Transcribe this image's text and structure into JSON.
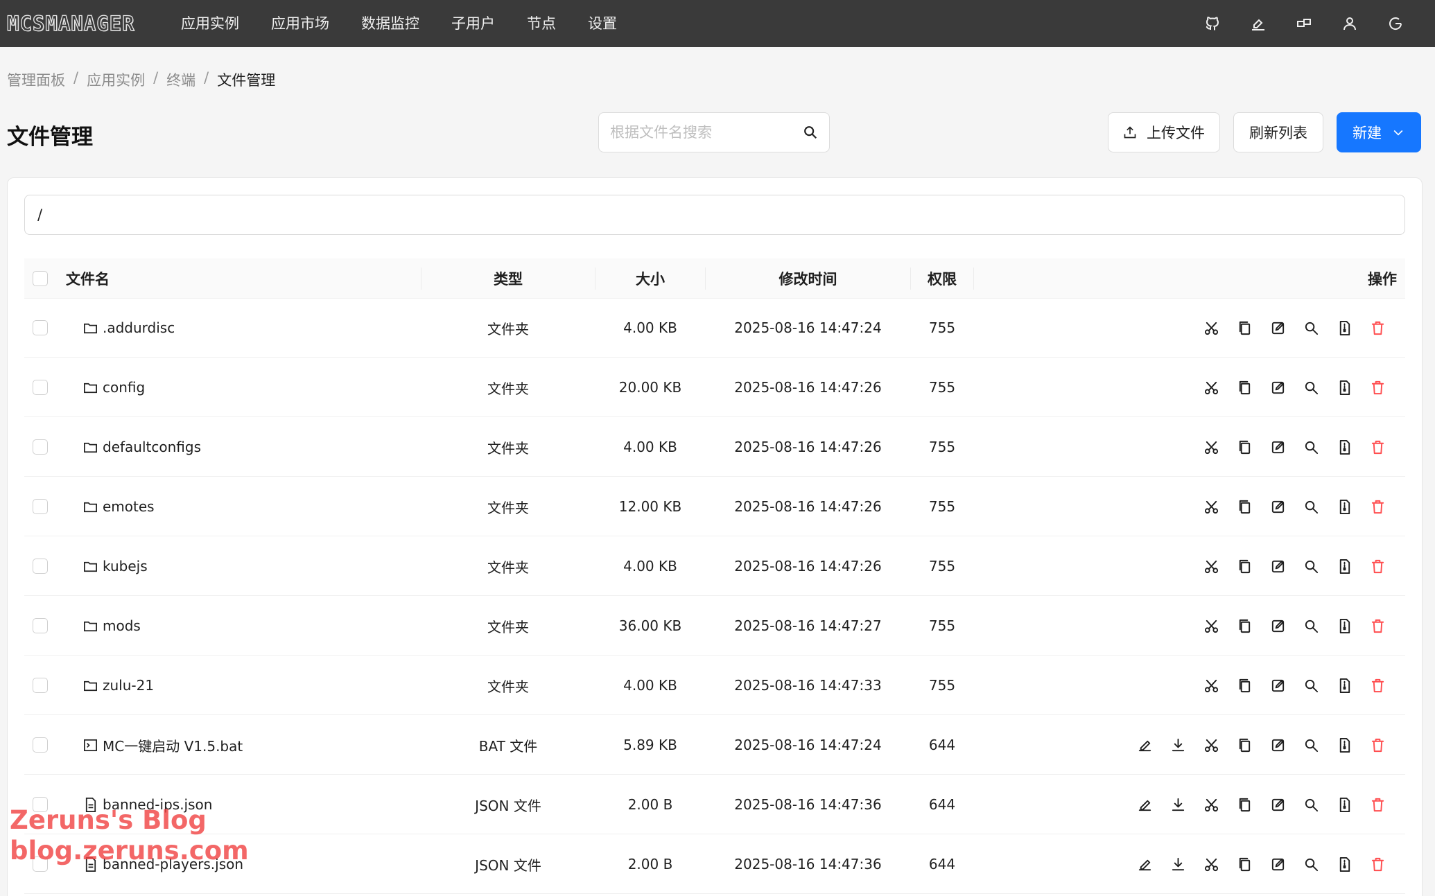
{
  "app": {
    "logo_text": "MCSMANAGER",
    "nav": [
      "应用实例",
      "应用市场",
      "数据监控",
      "子用户",
      "节点",
      "设置"
    ],
    "top_icons": [
      "github-icon",
      "theme-brush-icon",
      "layout-icon",
      "user-icon",
      "logout-icon"
    ]
  },
  "breadcrumb": [
    "管理面板",
    "应用实例",
    "终端",
    "文件管理"
  ],
  "breadcrumb_sep": "/",
  "page_title": "文件管理",
  "search": {
    "placeholder": "根据文件名搜索",
    "value": ""
  },
  "toolbar": {
    "upload_label": "上传文件",
    "refresh_label": "刷新列表",
    "new_label": "新建"
  },
  "path": "/",
  "table": {
    "columns": {
      "name": "文件名",
      "type": "类型",
      "size": "大小",
      "modified": "修改时间",
      "perm": "权限",
      "ops": "操作"
    },
    "rows": [
      {
        "name": ".addurdisc",
        "kind": "folder",
        "type": "文件夹",
        "size": "4.00 KB",
        "modified": "2025-08-16 14:47:24",
        "perm": "755"
      },
      {
        "name": "config",
        "kind": "folder",
        "type": "文件夹",
        "size": "20.00 KB",
        "modified": "2025-08-16 14:47:26",
        "perm": "755"
      },
      {
        "name": "defaultconfigs",
        "kind": "folder",
        "type": "文件夹",
        "size": "4.00 KB",
        "modified": "2025-08-16 14:47:26",
        "perm": "755"
      },
      {
        "name": "emotes",
        "kind": "folder",
        "type": "文件夹",
        "size": "12.00 KB",
        "modified": "2025-08-16 14:47:26",
        "perm": "755"
      },
      {
        "name": "kubejs",
        "kind": "folder",
        "type": "文件夹",
        "size": "4.00 KB",
        "modified": "2025-08-16 14:47:26",
        "perm": "755"
      },
      {
        "name": "mods",
        "kind": "folder",
        "type": "文件夹",
        "size": "36.00 KB",
        "modified": "2025-08-16 14:47:27",
        "perm": "755"
      },
      {
        "name": "zulu-21",
        "kind": "folder",
        "type": "文件夹",
        "size": "4.00 KB",
        "modified": "2025-08-16 14:47:33",
        "perm": "755"
      },
      {
        "name": "MC一键启动 V1.5.bat",
        "kind": "script",
        "type": "BAT 文件",
        "size": "5.89 KB",
        "modified": "2025-08-16 14:47:24",
        "perm": "644"
      },
      {
        "name": "banned-ips.json",
        "kind": "file",
        "type": "JSON 文件",
        "size": "2.00 B",
        "modified": "2025-08-16 14:47:36",
        "perm": "644"
      },
      {
        "name": "banned-players.json",
        "kind": "file",
        "type": "JSON 文件",
        "size": "2.00 B",
        "modified": "2025-08-16 14:47:36",
        "perm": "644"
      }
    ]
  },
  "watermark": [
    "Zeruns's Blog",
    "blog.zeruns.com"
  ]
}
